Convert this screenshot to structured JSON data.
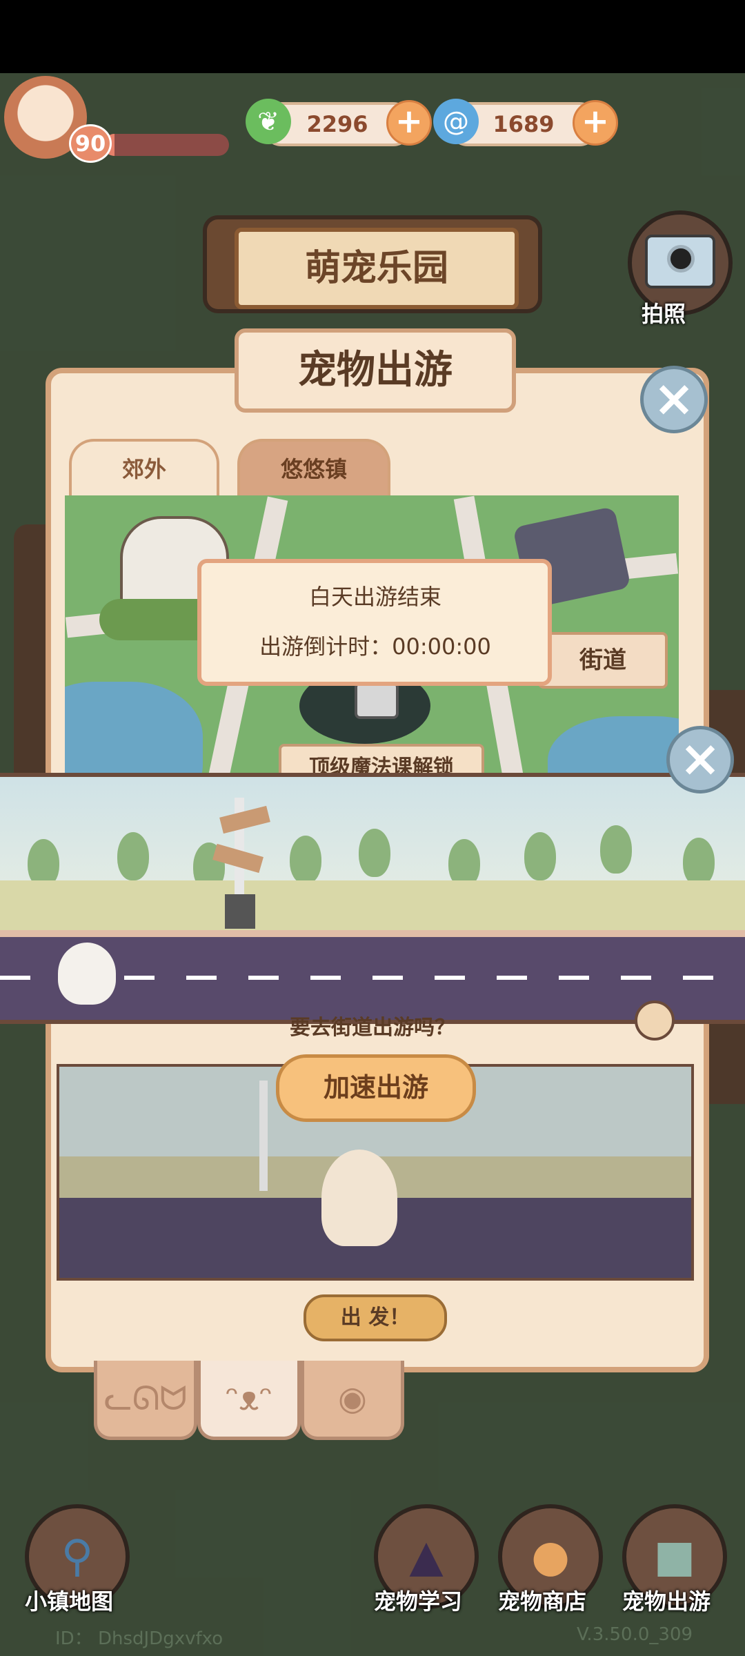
{
  "hud": {
    "level": "90",
    "xp_fraction": 0.05,
    "currency_leaf": "2296",
    "currency_swirl": "1689",
    "plus_symbol": "+"
  },
  "header": {
    "park_title": "萌宠乐园",
    "camera_label": "拍照"
  },
  "dialog": {
    "title": "宠物出游",
    "close_symbol": "×",
    "tabs": [
      {
        "label": "郊外",
        "selected": false
      },
      {
        "label": "悠悠镇",
        "selected": true
      }
    ],
    "street_label": "街道",
    "locked_banner": "顶级魔法课解锁",
    "notice": {
      "title": "白天出游结束",
      "countdown_label": "出游倒计时：",
      "countdown_value": "00:00:00"
    },
    "question_text": "要去街道出游吗？",
    "accelerate_button": "加速出游",
    "depart_button": "出 发！"
  },
  "bottom_nav": {
    "town_map": "小镇地图",
    "pet_study": "宠物学习",
    "pet_shop": "宠物商店",
    "pet_outing": "宠物出游"
  },
  "footer": {
    "id_text": "ID： DhsdJDgxvfxo",
    "version": "V.3.50.0_309"
  },
  "colors": {
    "accent_orange": "#f3a45f",
    "panel_bg": "#f7e6d0",
    "panel_border": "#d3a27a"
  }
}
